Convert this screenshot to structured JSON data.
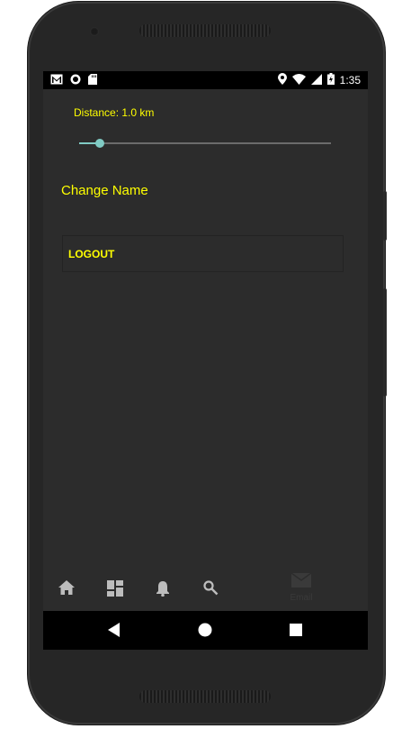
{
  "status_bar": {
    "left_icons": [
      "gmail-icon",
      "circle-notification-icon",
      "sd-card-icon"
    ],
    "right_icons": [
      "location-icon",
      "wifi-icon",
      "signal-icon",
      "battery-icon"
    ],
    "time": "1:35"
  },
  "settings": {
    "distance_label": "Distance: 1.0 km",
    "distance_slider_fraction": 0.04,
    "change_name_label": "Change Name",
    "logout_label": "LOGOUT"
  },
  "bottom_nav": {
    "items": [
      {
        "icon": "home-icon"
      },
      {
        "icon": "dashboard-icon"
      },
      {
        "icon": "bell-icon"
      },
      {
        "icon": "search-icon"
      },
      {
        "icon": "email-icon",
        "label": "Email"
      }
    ]
  },
  "system_nav": {
    "buttons": [
      "back-icon",
      "home-circle-icon",
      "recents-icon"
    ]
  },
  "colors": {
    "accent_text": "#ffff00",
    "slider_accent": "#80cbc4",
    "background": "#2c2c2c"
  }
}
